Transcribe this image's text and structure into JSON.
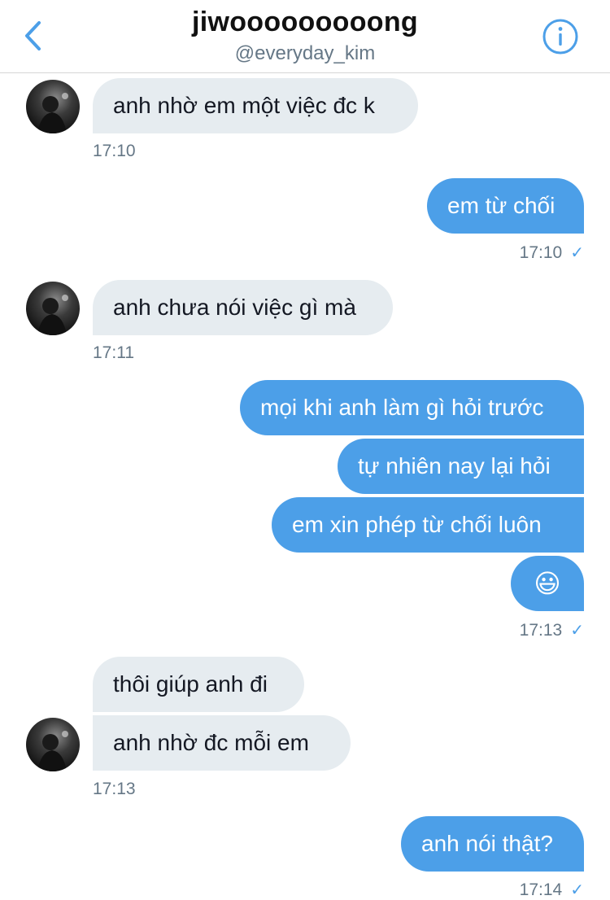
{
  "header": {
    "title": "jiwooooooooong",
    "subtitle": "@everyday_kim",
    "back_icon": "chevron-left-icon",
    "info_icon": "info-icon"
  },
  "colors": {
    "accent": "#4c9fe8",
    "incoming_bubble": "#e6ecf0",
    "timestamp": "#657786"
  },
  "messages": [
    {
      "dir": "in",
      "text": "anh nhờ em một việc đc k"
    },
    {
      "time": "17:10"
    },
    {
      "dir": "out",
      "text": "em từ chối"
    },
    {
      "time": "17:10",
      "read_icon": "✓"
    },
    {
      "dir": "in",
      "text": "anh chưa nói việc gì mà"
    },
    {
      "time": "17:11"
    },
    {
      "dir": "out",
      "text": "mọi khi anh làm gì hỏi trước"
    },
    {
      "dir": "out",
      "text": "tự nhiên nay lại hỏi"
    },
    {
      "dir": "out",
      "text": "em xin phép từ chối luôn"
    },
    {
      "dir": "out",
      "text": "😃"
    },
    {
      "time": "17:13",
      "read_icon": "✓"
    },
    {
      "dir": "in",
      "text": "thôi giúp anh đi"
    },
    {
      "dir": "in",
      "text": "anh nhờ đc mỗi em"
    },
    {
      "time": "17:13"
    },
    {
      "dir": "out",
      "text": "anh nói thật?"
    },
    {
      "time": "17:14",
      "read_icon": "✓"
    }
  ]
}
